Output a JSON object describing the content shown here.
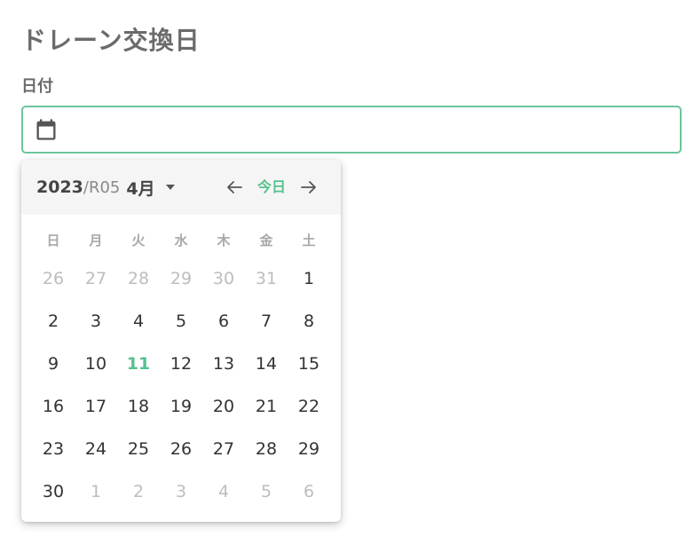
{
  "page": {
    "title": "ドレーン交換日"
  },
  "field": {
    "label": "日付",
    "value": "",
    "placeholder": ""
  },
  "picker": {
    "year": "2023",
    "era": "/R05",
    "month": "4月",
    "today_label": "今日",
    "accent_color": "#55c18d",
    "weekdays": [
      "日",
      "月",
      "火",
      "水",
      "木",
      "金",
      "土"
    ],
    "days": [
      {
        "label": "26",
        "muted": true
      },
      {
        "label": "27",
        "muted": true
      },
      {
        "label": "28",
        "muted": true
      },
      {
        "label": "29",
        "muted": true
      },
      {
        "label": "30",
        "muted": true
      },
      {
        "label": "31",
        "muted": true
      },
      {
        "label": "1"
      },
      {
        "label": "2"
      },
      {
        "label": "3"
      },
      {
        "label": "4"
      },
      {
        "label": "5"
      },
      {
        "label": "6"
      },
      {
        "label": "7"
      },
      {
        "label": "8"
      },
      {
        "label": "9"
      },
      {
        "label": "10"
      },
      {
        "label": "11",
        "today": true
      },
      {
        "label": "12"
      },
      {
        "label": "13"
      },
      {
        "label": "14"
      },
      {
        "label": "15"
      },
      {
        "label": "16"
      },
      {
        "label": "17"
      },
      {
        "label": "18"
      },
      {
        "label": "19"
      },
      {
        "label": "20"
      },
      {
        "label": "21"
      },
      {
        "label": "22"
      },
      {
        "label": "23"
      },
      {
        "label": "24"
      },
      {
        "label": "25"
      },
      {
        "label": "26"
      },
      {
        "label": "27"
      },
      {
        "label": "28"
      },
      {
        "label": "29"
      },
      {
        "label": "30"
      },
      {
        "label": "1",
        "muted": true
      },
      {
        "label": "2",
        "muted": true
      },
      {
        "label": "3",
        "muted": true
      },
      {
        "label": "4",
        "muted": true
      },
      {
        "label": "5",
        "muted": true
      },
      {
        "label": "6",
        "muted": true
      }
    ],
    "icons": {
      "calendar": "calendar-icon",
      "caret": "caret-down-icon",
      "prev": "arrow-left-icon",
      "next": "arrow-right-icon"
    }
  }
}
